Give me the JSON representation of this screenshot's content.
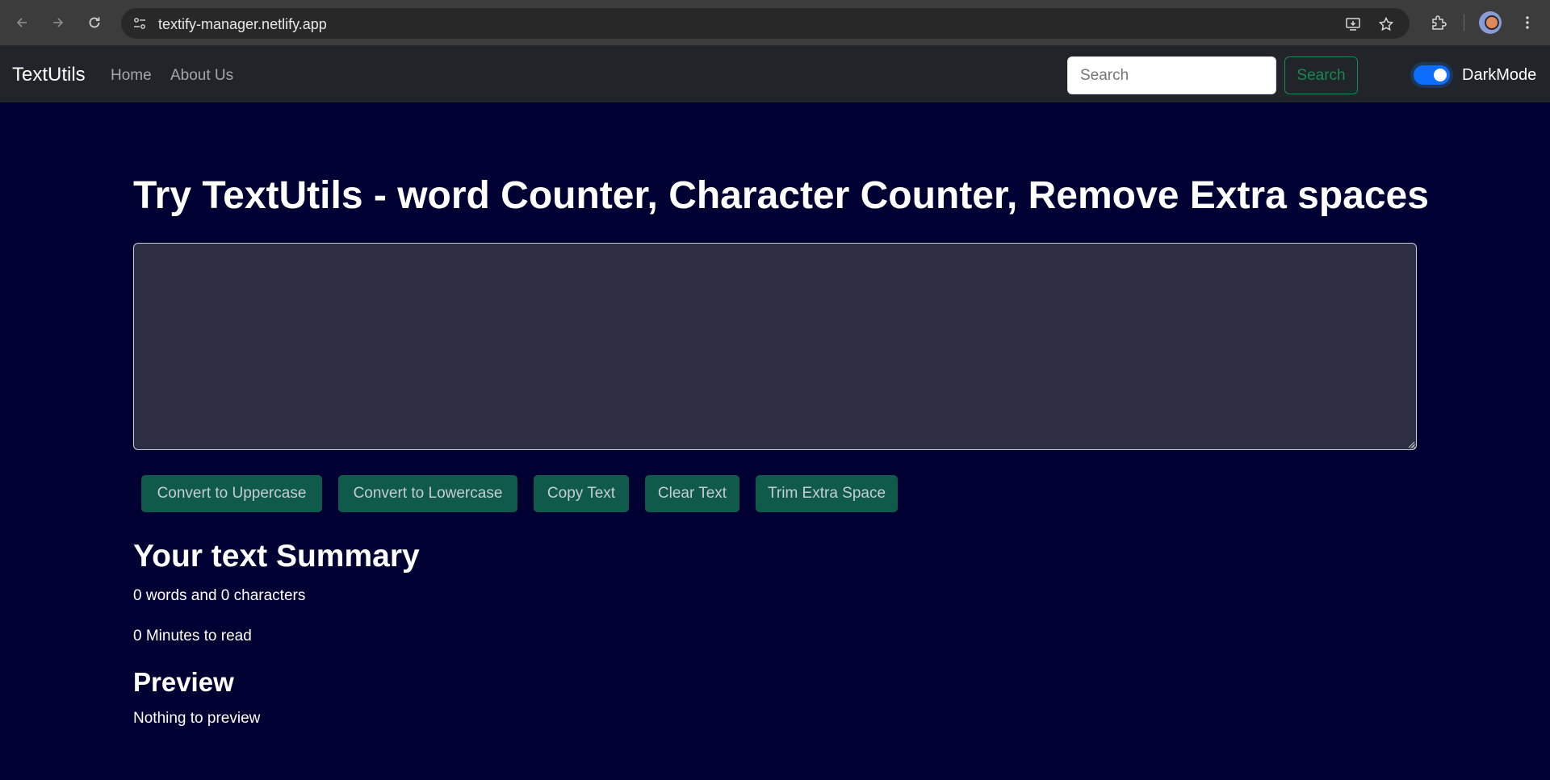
{
  "browser": {
    "url": "textify-manager.netlify.app"
  },
  "navbar": {
    "brand": "TextUtils",
    "links": [
      "Home",
      "About Us"
    ],
    "search_placeholder": "Search",
    "search_button": "Search",
    "dark_mode_label": "DarkMode",
    "dark_mode_on": true
  },
  "main": {
    "heading": "Try TextUtils - word Counter, Character Counter, Remove Extra spaces",
    "textarea_value": "",
    "buttons": [
      "Convert to Uppercase",
      "Convert to Lowercase",
      "Copy Text",
      "Clear Text",
      "Trim Extra Space"
    ],
    "summary_title": "Your text Summary",
    "summary_counts": "0 words and 0 characters",
    "read_time": "0 Minutes to read",
    "preview_title": "Preview",
    "preview_text": "Nothing to preview"
  },
  "colors": {
    "page_bg": "#000033",
    "navbar_bg": "#212529",
    "textarea_bg": "#2d2e44",
    "button_bg": "#0f5a4a",
    "accent_green": "#198754",
    "toggle_blue": "#0d6efd"
  }
}
